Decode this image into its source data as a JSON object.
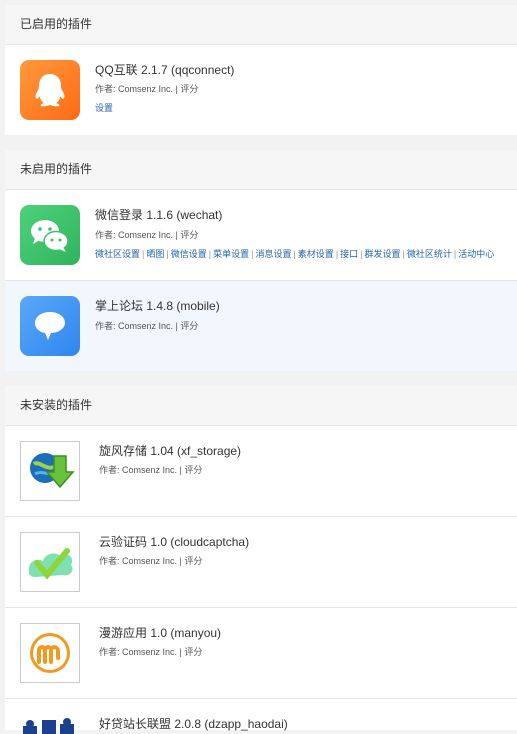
{
  "enabled": {
    "header": "已启用的插件",
    "plugins": [
      {
        "name": "QQ互联 2.1.7 (qqconnect)",
        "author": "作者: Comsenz Inc. | 评分",
        "links": [
          "设置"
        ],
        "icon": "qq-penguin-icon"
      }
    ]
  },
  "disabled": {
    "header": "未启用的插件",
    "plugins": [
      {
        "name": "微信登录 1.1.6 (wechat)",
        "author": "作者: Comsenz Inc. | 评分",
        "links": [
          "微社区设置",
          "晒图",
          "微信设置",
          "菜单设置",
          "消息设置",
          "素材设置",
          "接口",
          "群发设置",
          "微社区统计",
          "活动中心"
        ],
        "icon": "wechat-icon"
      },
      {
        "name": "掌上论坛 1.4.8 (mobile)",
        "author": "作者: Comsenz Inc. | 评分",
        "links": [],
        "icon": "mobile-chat-bubble-icon"
      }
    ]
  },
  "not_installed": {
    "header": "未安装的插件",
    "plugins": [
      {
        "name": "旋风存储 1.04 (xf_storage)",
        "author": "作者: Comsenz Inc. | 评分",
        "icon": "globe-download-icon"
      },
      {
        "name": "云验证码 1.0 (cloudcaptcha)",
        "author": "作者: Comsenz Inc. | 评分",
        "icon": "cloud-check-icon"
      },
      {
        "name": "漫游应用 1.0 (manyou)",
        "author": "作者: Comsenz Inc. | 评分",
        "icon": "manyou-m-icon"
      },
      {
        "name": "好贷站长联盟 2.0.8 (dzapp_haodai)",
        "icon": "haodai-puzzle-icon"
      }
    ]
  },
  "colors": {
    "link": "#2366a8",
    "qq": "#ff7a1c",
    "wechat": "#3cc36a",
    "mobile": "#3a94f5"
  }
}
